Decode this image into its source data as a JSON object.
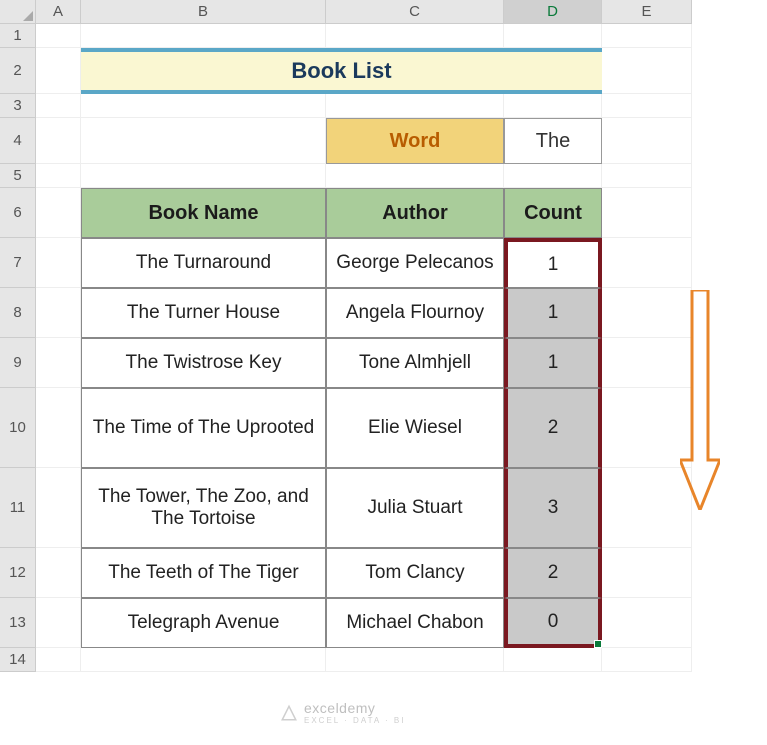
{
  "columns": [
    "A",
    "B",
    "C",
    "D",
    "E"
  ],
  "rows": [
    "1",
    "2",
    "3",
    "4",
    "5",
    "6",
    "7",
    "8",
    "9",
    "10",
    "11",
    "12",
    "13",
    "14"
  ],
  "active_column": "D",
  "title": "Book List",
  "word_label": "Word",
  "word_value": "The",
  "table": {
    "headers": {
      "book": "Book Name",
      "author": "Author",
      "count": "Count"
    },
    "rows": [
      {
        "book": "The Turnaround",
        "author": "George Pelecanos",
        "count": "1"
      },
      {
        "book": "The Turner House",
        "author": "Angela Flournoy",
        "count": "1"
      },
      {
        "book": "The Twistrose Key",
        "author": "Tone Almhjell",
        "count": "1"
      },
      {
        "book": "The Time of The Uprooted",
        "author": "Elie Wiesel",
        "count": "2"
      },
      {
        "book": "The Tower, The Zoo, and The Tortoise",
        "author": "Julia Stuart",
        "count": "3"
      },
      {
        "book": "The Teeth of The Tiger",
        "author": "Tom Clancy",
        "count": "2"
      },
      {
        "book": "Telegraph Avenue",
        "author": "Michael Chabon",
        "count": "0"
      }
    ]
  },
  "watermark": {
    "brand": "exceldemy",
    "tagline": "EXCEL · DATA · BI"
  },
  "highlight": {
    "column": "D",
    "color": "#7a1820"
  },
  "arrow": {
    "direction": "down",
    "color": "#e8852a"
  }
}
